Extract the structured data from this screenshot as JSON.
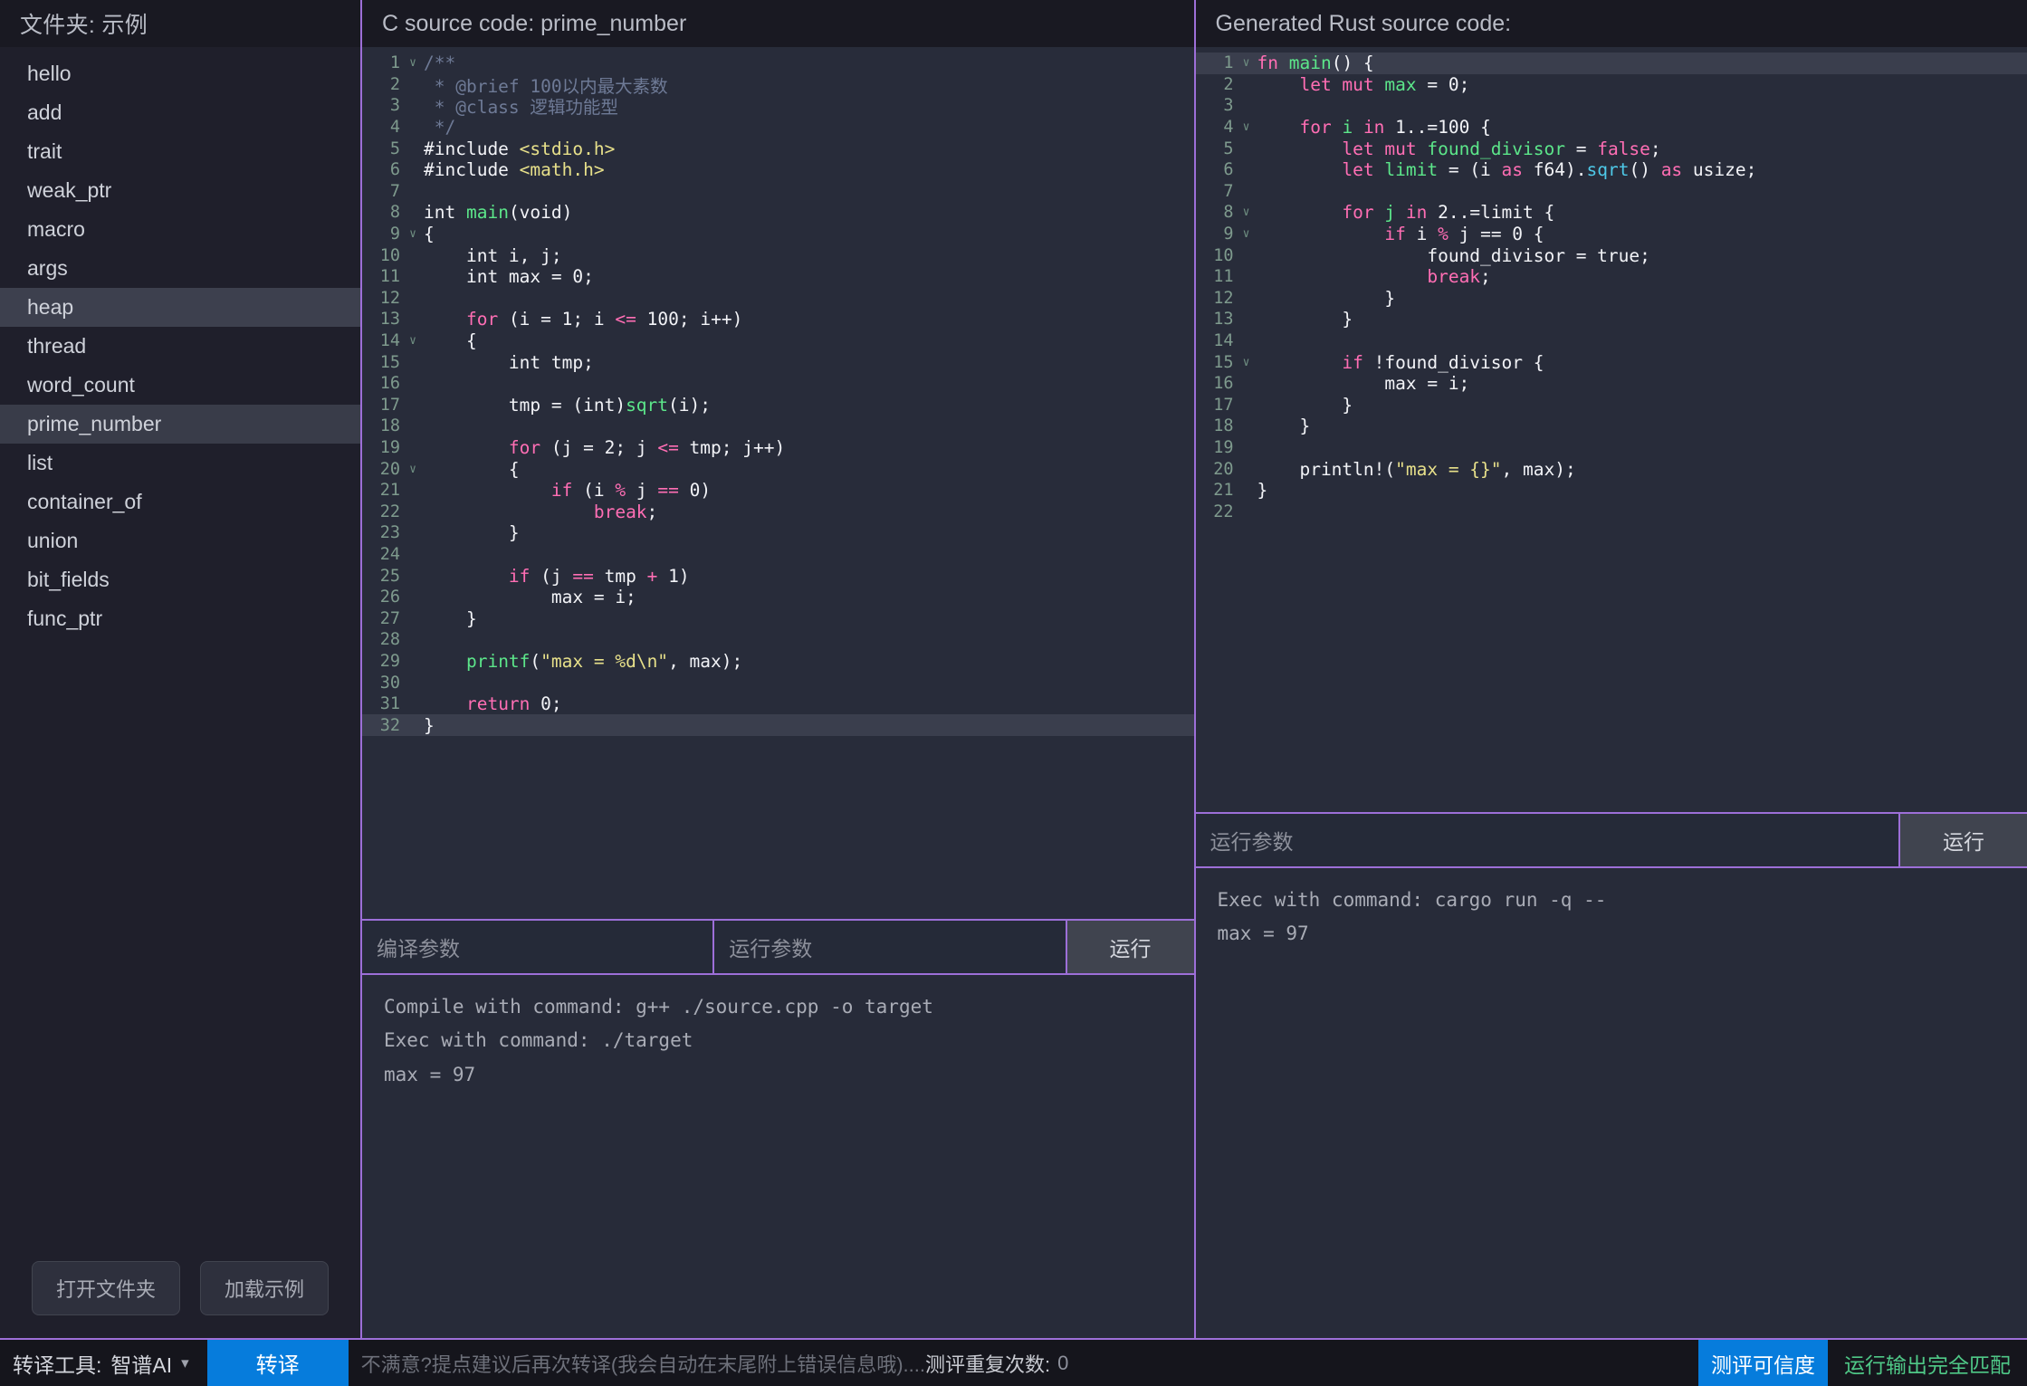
{
  "sidebar": {
    "header": "文件夹: 示例",
    "items": [
      {
        "label": "hello",
        "state": "none"
      },
      {
        "label": "add",
        "state": "none"
      },
      {
        "label": "trait",
        "state": "none"
      },
      {
        "label": "weak_ptr",
        "state": "none"
      },
      {
        "label": "macro",
        "state": "none"
      },
      {
        "label": "args",
        "state": "none"
      },
      {
        "label": "heap",
        "state": "hover"
      },
      {
        "label": "thread",
        "state": "none"
      },
      {
        "label": "word_count",
        "state": "none"
      },
      {
        "label": "prime_number",
        "state": "selected"
      },
      {
        "label": "list",
        "state": "none"
      },
      {
        "label": "container_of",
        "state": "none"
      },
      {
        "label": "union",
        "state": "none"
      },
      {
        "label": "bit_fields",
        "state": "none"
      },
      {
        "label": "func_ptr",
        "state": "none"
      }
    ],
    "open_folder_button": "打开文件夹",
    "load_example_button": "加载示例"
  },
  "c_panel": {
    "header": "C source code: prime_number",
    "lines": [
      {
        "n": 1,
        "fold": "v",
        "hl": false,
        "tokens": [
          {
            "t": "/**",
            "c": "c-com"
          }
        ]
      },
      {
        "n": 2,
        "fold": "",
        "hl": false,
        "tokens": [
          {
            "t": " * @brief 100以内最大素数",
            "c": "c-com"
          }
        ]
      },
      {
        "n": 3,
        "fold": "",
        "hl": false,
        "tokens": [
          {
            "t": " * @class 逻辑功能型",
            "c": "c-com"
          }
        ]
      },
      {
        "n": 4,
        "fold": "",
        "hl": false,
        "tokens": [
          {
            "t": " */",
            "c": "c-com"
          }
        ]
      },
      {
        "n": 5,
        "fold": "",
        "hl": false,
        "tokens": [
          {
            "t": "#include ",
            "c": "c-pre"
          },
          {
            "t": "<stdio.h>",
            "c": "c-str"
          }
        ]
      },
      {
        "n": 6,
        "fold": "",
        "hl": false,
        "tokens": [
          {
            "t": "#include ",
            "c": "c-pre"
          },
          {
            "t": "<math.h>",
            "c": "c-str"
          }
        ]
      },
      {
        "n": 7,
        "fold": "",
        "hl": false,
        "tokens": []
      },
      {
        "n": 8,
        "fold": "",
        "hl": false,
        "tokens": [
          {
            "t": "int ",
            "c": "c-type"
          },
          {
            "t": "main",
            "c": "c-fn"
          },
          {
            "t": "(void)",
            "c": "c-type"
          }
        ]
      },
      {
        "n": 9,
        "fold": "v",
        "hl": false,
        "tokens": [
          {
            "t": "{",
            "c": "c-type"
          }
        ]
      },
      {
        "n": 10,
        "fold": "",
        "hl": false,
        "tokens": [
          {
            "t": "    int i, j;",
            "c": "c-type"
          }
        ]
      },
      {
        "n": 11,
        "fold": "",
        "hl": false,
        "tokens": [
          {
            "t": "    int max = ",
            "c": "c-type"
          },
          {
            "t": "0",
            "c": "c-num"
          },
          {
            "t": ";",
            "c": "c-type"
          }
        ]
      },
      {
        "n": 12,
        "fold": "",
        "hl": false,
        "tokens": []
      },
      {
        "n": 13,
        "fold": "",
        "hl": false,
        "tokens": [
          {
            "t": "    ",
            "c": "c-type"
          },
          {
            "t": "for",
            "c": "c-kw"
          },
          {
            "t": " (i = ",
            "c": "c-type"
          },
          {
            "t": "1",
            "c": "c-num"
          },
          {
            "t": "; i ",
            "c": "c-type"
          },
          {
            "t": "<=",
            "c": "c-op"
          },
          {
            "t": " ",
            "c": "c-type"
          },
          {
            "t": "100",
            "c": "c-num"
          },
          {
            "t": "; i",
            "c": "c-type"
          },
          {
            "t": "++",
            "c": "c-type"
          },
          {
            "t": ")",
            "c": "c-type"
          }
        ]
      },
      {
        "n": 14,
        "fold": "v",
        "hl": false,
        "tokens": [
          {
            "t": "    {",
            "c": "c-type"
          }
        ]
      },
      {
        "n": 15,
        "fold": "",
        "hl": false,
        "tokens": [
          {
            "t": "        int tmp;",
            "c": "c-type"
          }
        ]
      },
      {
        "n": 16,
        "fold": "",
        "hl": false,
        "tokens": []
      },
      {
        "n": 17,
        "fold": "",
        "hl": false,
        "tokens": [
          {
            "t": "        tmp = (int)",
            "c": "c-type"
          },
          {
            "t": "sqrt",
            "c": "c-fn"
          },
          {
            "t": "(i);",
            "c": "c-type"
          }
        ]
      },
      {
        "n": 18,
        "fold": "",
        "hl": false,
        "tokens": []
      },
      {
        "n": 19,
        "fold": "",
        "hl": false,
        "tokens": [
          {
            "t": "        ",
            "c": "c-type"
          },
          {
            "t": "for",
            "c": "c-kw"
          },
          {
            "t": " (j = ",
            "c": "c-type"
          },
          {
            "t": "2",
            "c": "c-num"
          },
          {
            "t": "; j ",
            "c": "c-type"
          },
          {
            "t": "<=",
            "c": "c-op"
          },
          {
            "t": " tmp; j++)",
            "c": "c-type"
          }
        ]
      },
      {
        "n": 20,
        "fold": "v",
        "hl": false,
        "tokens": [
          {
            "t": "        {",
            "c": "c-type"
          }
        ]
      },
      {
        "n": 21,
        "fold": "",
        "hl": false,
        "tokens": [
          {
            "t": "            ",
            "c": "c-type"
          },
          {
            "t": "if",
            "c": "c-kw"
          },
          {
            "t": " (i ",
            "c": "c-type"
          },
          {
            "t": "%",
            "c": "c-op"
          },
          {
            "t": " j ",
            "c": "c-type"
          },
          {
            "t": "==",
            "c": "c-op"
          },
          {
            "t": " ",
            "c": "c-type"
          },
          {
            "t": "0",
            "c": "c-num"
          },
          {
            "t": ")",
            "c": "c-type"
          }
        ]
      },
      {
        "n": 22,
        "fold": "",
        "hl": false,
        "tokens": [
          {
            "t": "                ",
            "c": "c-type"
          },
          {
            "t": "break",
            "c": "c-kw"
          },
          {
            "t": ";",
            "c": "c-type"
          }
        ]
      },
      {
        "n": 23,
        "fold": "",
        "hl": false,
        "tokens": [
          {
            "t": "        }",
            "c": "c-type"
          }
        ]
      },
      {
        "n": 24,
        "fold": "",
        "hl": false,
        "tokens": []
      },
      {
        "n": 25,
        "fold": "",
        "hl": false,
        "tokens": [
          {
            "t": "        ",
            "c": "c-type"
          },
          {
            "t": "if",
            "c": "c-kw"
          },
          {
            "t": " (j ",
            "c": "c-type"
          },
          {
            "t": "==",
            "c": "c-op"
          },
          {
            "t": " tmp ",
            "c": "c-type"
          },
          {
            "t": "+",
            "c": "c-op"
          },
          {
            "t": " ",
            "c": "c-type"
          },
          {
            "t": "1",
            "c": "c-num"
          },
          {
            "t": ")",
            "c": "c-type"
          }
        ]
      },
      {
        "n": 26,
        "fold": "",
        "hl": false,
        "tokens": [
          {
            "t": "            max = i;",
            "c": "c-type"
          }
        ]
      },
      {
        "n": 27,
        "fold": "",
        "hl": false,
        "tokens": [
          {
            "t": "    }",
            "c": "c-type"
          }
        ]
      },
      {
        "n": 28,
        "fold": "",
        "hl": false,
        "tokens": []
      },
      {
        "n": 29,
        "fold": "",
        "hl": false,
        "tokens": [
          {
            "t": "    ",
            "c": "c-type"
          },
          {
            "t": "printf",
            "c": "c-fn"
          },
          {
            "t": "(",
            "c": "c-type"
          },
          {
            "t": "\"max = %d\\n\"",
            "c": "c-str"
          },
          {
            "t": ", max);",
            "c": "c-type"
          }
        ]
      },
      {
        "n": 30,
        "fold": "",
        "hl": false,
        "tokens": []
      },
      {
        "n": 31,
        "fold": "",
        "hl": false,
        "tokens": [
          {
            "t": "    ",
            "c": "c-type"
          },
          {
            "t": "return",
            "c": "c-kw"
          },
          {
            "t": " ",
            "c": "c-type"
          },
          {
            "t": "0",
            "c": "c-num"
          },
          {
            "t": ";",
            "c": "c-type"
          }
        ]
      },
      {
        "n": 32,
        "fold": "",
        "hl": true,
        "tokens": [
          {
            "t": "}",
            "c": "c-type"
          }
        ]
      }
    ],
    "compile_params_placeholder": "编译参数",
    "run_params_placeholder": "运行参数",
    "run_button": "运行",
    "console": [
      "Compile with command: g++ ./source.cpp -o target",
      "Exec with command: ./target",
      "max = 97"
    ]
  },
  "rust_panel": {
    "header": "Generated Rust source code:",
    "lines": [
      {
        "n": 1,
        "fold": "v",
        "hl": true,
        "tokens": [
          {
            "t": "fn ",
            "c": "c-kw"
          },
          {
            "t": "main",
            "c": "c-fn"
          },
          {
            "t": "() {",
            "c": "c-type"
          }
        ]
      },
      {
        "n": 2,
        "fold": "",
        "hl": false,
        "tokens": [
          {
            "t": "    ",
            "c": "c-type"
          },
          {
            "t": "let mut ",
            "c": "c-kw"
          },
          {
            "t": "max",
            "c": "c-var"
          },
          {
            "t": " = ",
            "c": "c-type"
          },
          {
            "t": "0",
            "c": "c-num"
          },
          {
            "t": ";",
            "c": "c-type"
          }
        ]
      },
      {
        "n": 3,
        "fold": "",
        "hl": false,
        "tokens": []
      },
      {
        "n": 4,
        "fold": "v",
        "hl": false,
        "tokens": [
          {
            "t": "    ",
            "c": "c-type"
          },
          {
            "t": "for ",
            "c": "c-kw"
          },
          {
            "t": "i",
            "c": "c-var"
          },
          {
            "t": " ",
            "c": "c-type"
          },
          {
            "t": "in",
            "c": "c-kw"
          },
          {
            "t": " 1..=100 {",
            "c": "c-type"
          }
        ]
      },
      {
        "n": 5,
        "fold": "",
        "hl": false,
        "tokens": [
          {
            "t": "        ",
            "c": "c-type"
          },
          {
            "t": "let mut ",
            "c": "c-kw"
          },
          {
            "t": "found_divisor",
            "c": "c-var"
          },
          {
            "t": " = ",
            "c": "c-type"
          },
          {
            "t": "false",
            "c": "c-kw"
          },
          {
            "t": ";",
            "c": "c-type"
          }
        ]
      },
      {
        "n": 6,
        "fold": "",
        "hl": false,
        "tokens": [
          {
            "t": "        ",
            "c": "c-type"
          },
          {
            "t": "let ",
            "c": "c-kw"
          },
          {
            "t": "limit",
            "c": "c-var"
          },
          {
            "t": " = (i ",
            "c": "c-type"
          },
          {
            "t": "as",
            "c": "c-kw"
          },
          {
            "t": " f64).",
            "c": "c-type"
          },
          {
            "t": "sqrt",
            "c": "c-meth"
          },
          {
            "t": "() ",
            "c": "c-type"
          },
          {
            "t": "as",
            "c": "c-kw"
          },
          {
            "t": " usize;",
            "c": "c-type"
          }
        ]
      },
      {
        "n": 7,
        "fold": "",
        "hl": false,
        "tokens": []
      },
      {
        "n": 8,
        "fold": "v",
        "hl": false,
        "tokens": [
          {
            "t": "        ",
            "c": "c-type"
          },
          {
            "t": "for ",
            "c": "c-kw"
          },
          {
            "t": "j",
            "c": "c-var"
          },
          {
            "t": " ",
            "c": "c-type"
          },
          {
            "t": "in",
            "c": "c-kw"
          },
          {
            "t": " 2..=limit {",
            "c": "c-type"
          }
        ]
      },
      {
        "n": 9,
        "fold": "v",
        "hl": false,
        "tokens": [
          {
            "t": "            ",
            "c": "c-type"
          },
          {
            "t": "if",
            "c": "c-kw"
          },
          {
            "t": " i ",
            "c": "c-type"
          },
          {
            "t": "%",
            "c": "c-op"
          },
          {
            "t": " j == 0 {",
            "c": "c-type"
          }
        ]
      },
      {
        "n": 10,
        "fold": "",
        "hl": false,
        "tokens": [
          {
            "t": "                found_divisor = true;",
            "c": "c-type"
          }
        ]
      },
      {
        "n": 11,
        "fold": "",
        "hl": false,
        "tokens": [
          {
            "t": "                ",
            "c": "c-type"
          },
          {
            "t": "break",
            "c": "c-kw"
          },
          {
            "t": ";",
            "c": "c-type"
          }
        ]
      },
      {
        "n": 12,
        "fold": "",
        "hl": false,
        "tokens": [
          {
            "t": "            }",
            "c": "c-type"
          }
        ]
      },
      {
        "n": 13,
        "fold": "",
        "hl": false,
        "tokens": [
          {
            "t": "        }",
            "c": "c-type"
          }
        ]
      },
      {
        "n": 14,
        "fold": "",
        "hl": false,
        "tokens": []
      },
      {
        "n": 15,
        "fold": "v",
        "hl": false,
        "tokens": [
          {
            "t": "        ",
            "c": "c-type"
          },
          {
            "t": "if",
            "c": "c-kw"
          },
          {
            "t": " !found_divisor {",
            "c": "c-type"
          }
        ]
      },
      {
        "n": 16,
        "fold": "",
        "hl": false,
        "tokens": [
          {
            "t": "            max = i;",
            "c": "c-type"
          }
        ]
      },
      {
        "n": 17,
        "fold": "",
        "hl": false,
        "tokens": [
          {
            "t": "        }",
            "c": "c-type"
          }
        ]
      },
      {
        "n": 18,
        "fold": "",
        "hl": false,
        "tokens": [
          {
            "t": "    }",
            "c": "c-type"
          }
        ]
      },
      {
        "n": 19,
        "fold": "",
        "hl": false,
        "tokens": []
      },
      {
        "n": 20,
        "fold": "",
        "hl": false,
        "tokens": [
          {
            "t": "    println!(",
            "c": "c-type"
          },
          {
            "t": "\"max = {}\"",
            "c": "c-str"
          },
          {
            "t": ", max);",
            "c": "c-type"
          }
        ]
      },
      {
        "n": 21,
        "fold": "",
        "hl": false,
        "tokens": [
          {
            "t": "}",
            "c": "c-type"
          }
        ]
      },
      {
        "n": 22,
        "fold": "",
        "hl": false,
        "tokens": []
      }
    ],
    "run_params_placeholder": "运行参数",
    "run_button": "运行",
    "console": [
      "Exec with command: cargo run -q --",
      "max = 97"
    ]
  },
  "statusbar": {
    "tool_label": "转译工具:",
    "tool_value": "智谱AI",
    "translate_button": "转译",
    "hint": "不满意?提点建议后再次转译(我会自动在末尾附上错误信息哦)....",
    "repeat_label": "测评重复次数:",
    "repeat_value": "0",
    "confidence_badge": "测评可信度",
    "match_text": "运行输出完全匹配",
    "accent_color": "#067cdc",
    "match_color": "#4fc887"
  }
}
